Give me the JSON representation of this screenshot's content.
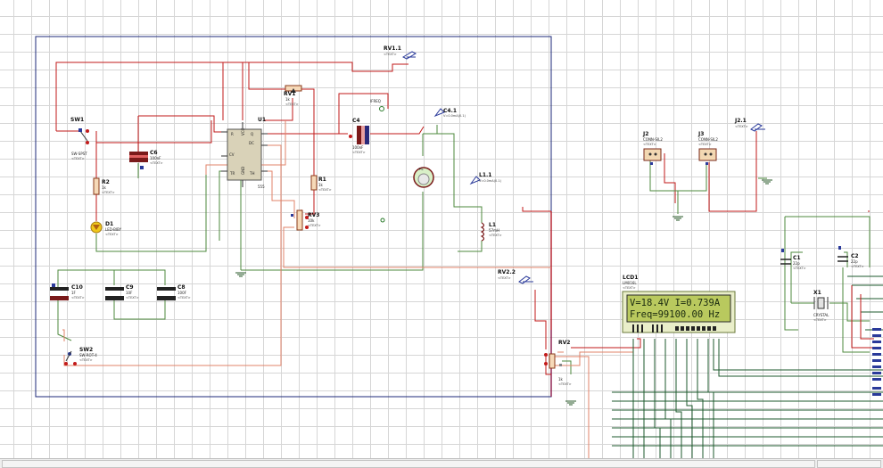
{
  "schematic": {
    "components": {
      "sw1": {
        "ref": "SW1",
        "value": "SW-SPST",
        "text": "<TEXT>"
      },
      "r2": {
        "ref": "R2",
        "value": "1k",
        "text": "<TEXT>"
      },
      "d1": {
        "ref": "D1",
        "value": "LED-BIBY",
        "text": "<TEXT>"
      },
      "c6": {
        "ref": "C6",
        "value": "100nF",
        "text": "<TEXT>"
      },
      "u1": {
        "ref": "U1",
        "value": "555",
        "text": "<TEXT>"
      },
      "rv1": {
        "ref": "RV1",
        "value": "1k",
        "text": "<TEXT>"
      },
      "r1": {
        "ref": "R1",
        "value": "1k",
        "text": "<TEXT>"
      },
      "rv3": {
        "ref": "RV3",
        "value": "10k",
        "text": "<TEXT>"
      },
      "c4": {
        "ref": "C4",
        "value": "100nF",
        "text": "<TEXT>"
      },
      "l1": {
        "ref": "L1",
        "value": "57mH",
        "text": "<TEXT>"
      },
      "c10": {
        "ref": "C10",
        "value": "1F",
        "text": "<TEXT>"
      },
      "c9": {
        "ref": "C9",
        "value": "10F",
        "text": "<TEXT>"
      },
      "c8": {
        "ref": "C8",
        "value": "100F",
        "text": "<TEXT>"
      },
      "sw2": {
        "ref": "SW2",
        "value": "SW-ROT-4",
        "text": "<TEXT>"
      },
      "j2": {
        "ref": "J2",
        "value": "CONN-SIL2",
        "text": "<TEXT>"
      },
      "j3": {
        "ref": "J3",
        "value": "CONN-SIL2",
        "text": "<TEXT>"
      },
      "lcd1": {
        "ref": "LCD1",
        "value": "LM016L",
        "text": "<TEXT>"
      },
      "rv2": {
        "ref": "RV2",
        "value": "1k",
        "text": "<TEXT>"
      },
      "c1": {
        "ref": "C1",
        "value": "22p",
        "text": "<TEXT>"
      },
      "c2": {
        "ref": "C2",
        "value": "22p",
        "text": "<TEXT>"
      },
      "x1": {
        "ref": "X1",
        "value": "CRYSTAL",
        "text": "<TEXT>"
      }
    },
    "timer_pins": {
      "r": "R",
      "cv": "CV",
      "dc": "DC",
      "q": "Q",
      "tr": "TR",
      "th": "TH",
      "gnd": "GND",
      "vcc": "VCC"
    },
    "terminals": {
      "rv1_sig": {
        "name": "RV1.1",
        "text": "<TEXT>"
      },
      "rv2_sig": {
        "name": "RV2.2",
        "text": "<TEXT>"
      },
      "ifreq": {
        "name": "IFREQ"
      },
      "j21": {
        "name": "J2.1",
        "text": "<TEXT>"
      },
      "c4_probe": {
        "name": "C4.1",
        "sub": "V=0.0mA(0.1)"
      },
      "l1_probe": {
        "name": "L1.1",
        "sub": "V=0.0mA(0.1)"
      }
    },
    "lamp_label": "+L",
    "lcd": {
      "line1": "V=18.4V I=0.739A",
      "line2": "Freq=99100.00 Hz"
    },
    "colors": {
      "wire_red": "#c21a1a",
      "wire_green": "#4e8a3e",
      "wire_salmon": "#e2836a",
      "frame_blue": "#1c2a7a",
      "lcd_bg": "#b9c95e"
    }
  }
}
